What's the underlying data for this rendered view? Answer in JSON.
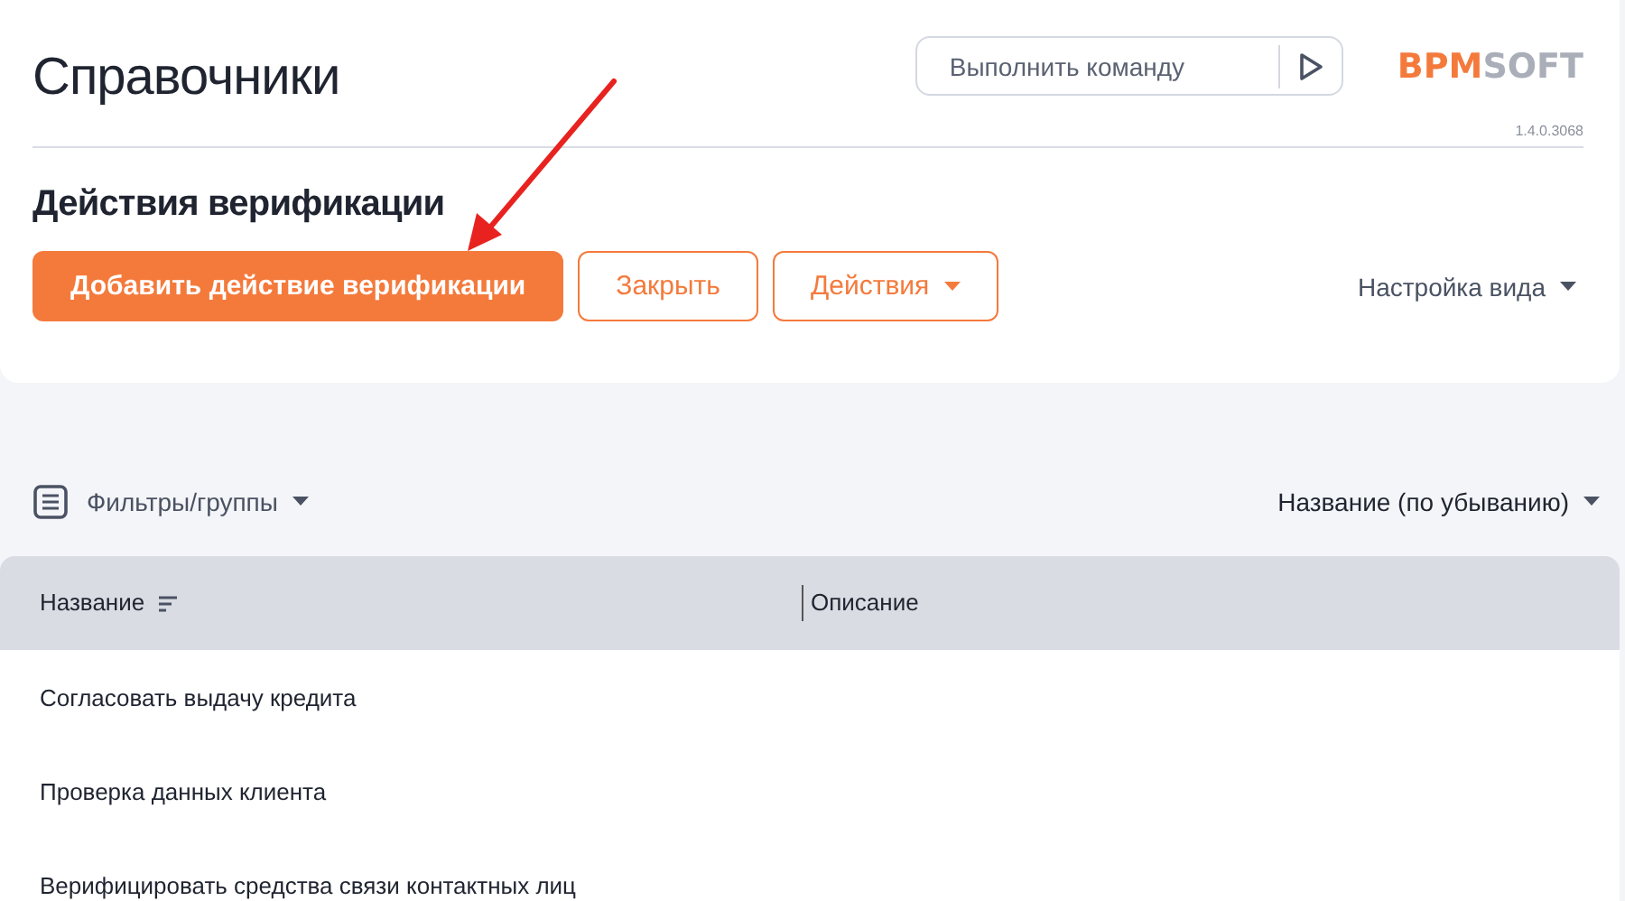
{
  "header": {
    "title": "Справочники",
    "command": {
      "placeholder": "Выполнить команду"
    },
    "logo": {
      "part_1": "BPM",
      "part_2": "SOFT"
    },
    "version": "1.4.0.3068"
  },
  "section": {
    "title": "Действия верификации",
    "buttons": [
      {
        "label": "Добавить действие верификации",
        "kind": "primary"
      },
      {
        "label": "Закрыть",
        "kind": "outline"
      },
      {
        "label": "Действия",
        "kind": "dropdown"
      }
    ],
    "view_settings": "Настройка вида"
  },
  "toolbar": {
    "filters": "Фильтры/группы",
    "sort": "Название (по убыванию)"
  },
  "table": {
    "columns": [
      {
        "label": "Название",
        "sorted": true
      },
      {
        "label": "Описание",
        "sorted": false
      }
    ],
    "rows": [
      [
        "Согласовать выдачу кредита",
        ""
      ],
      [
        "Проверка данных клиента",
        ""
      ],
      [
        "Верифицировать средства связи контактных лиц",
        ""
      ]
    ]
  }
}
